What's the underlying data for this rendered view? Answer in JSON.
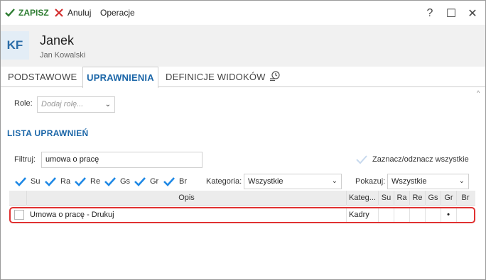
{
  "toolbar": {
    "save_label": "ZAPISZ",
    "cancel_label": "Anuluj",
    "operations_label": "Operacje"
  },
  "window_controls": {
    "help": "?",
    "maximize": "☐",
    "close": "✕"
  },
  "header": {
    "initials": "KF",
    "name": "Janek",
    "subtitle": "Jan Kowalski"
  },
  "tabs": [
    {
      "label": "PODSTAWOWE",
      "active": false
    },
    {
      "label": "UPRAWNIENIA",
      "active": true
    },
    {
      "label": "DEFINICJE WIDOKÓW",
      "active": false
    }
  ],
  "role": {
    "label": "Role:",
    "placeholder": "Dodaj rolę..."
  },
  "section_title": "LISTA UPRAWNIEŃ",
  "filter": {
    "label": "Filtruj:",
    "value": "umowa o pracę"
  },
  "toggle_all_label": "Zaznacz/odznacz wszystkie",
  "checkboxes": [
    {
      "label": "Su",
      "checked": true
    },
    {
      "label": "Ra",
      "checked": true
    },
    {
      "label": "Re",
      "checked": true
    },
    {
      "label": "Gs",
      "checked": true
    },
    {
      "label": "Gr",
      "checked": true
    },
    {
      "label": "Br",
      "checked": true
    }
  ],
  "category": {
    "label": "Kategoria:",
    "value": "Wszystkie"
  },
  "show": {
    "label": "Pokazuj:",
    "value": "Wszystkie"
  },
  "grid": {
    "columns": [
      "",
      "Opis",
      "Kateg...",
      "Su",
      "Ra",
      "Re",
      "Gs",
      "Gr",
      "Br"
    ],
    "rows": [
      {
        "checked": false,
        "opis": "Umowa o pracę - Drukuj",
        "kategoria": "Kadry",
        "su": "",
        "ra": "",
        "re": "",
        "gs": "",
        "gr": "•",
        "br": ""
      }
    ]
  },
  "colors": {
    "accent": "#1b66a8",
    "save_green": "#2e7d32",
    "cancel_red": "#d32f2f",
    "highlight": "#e03131",
    "check": "#1e88e5"
  }
}
